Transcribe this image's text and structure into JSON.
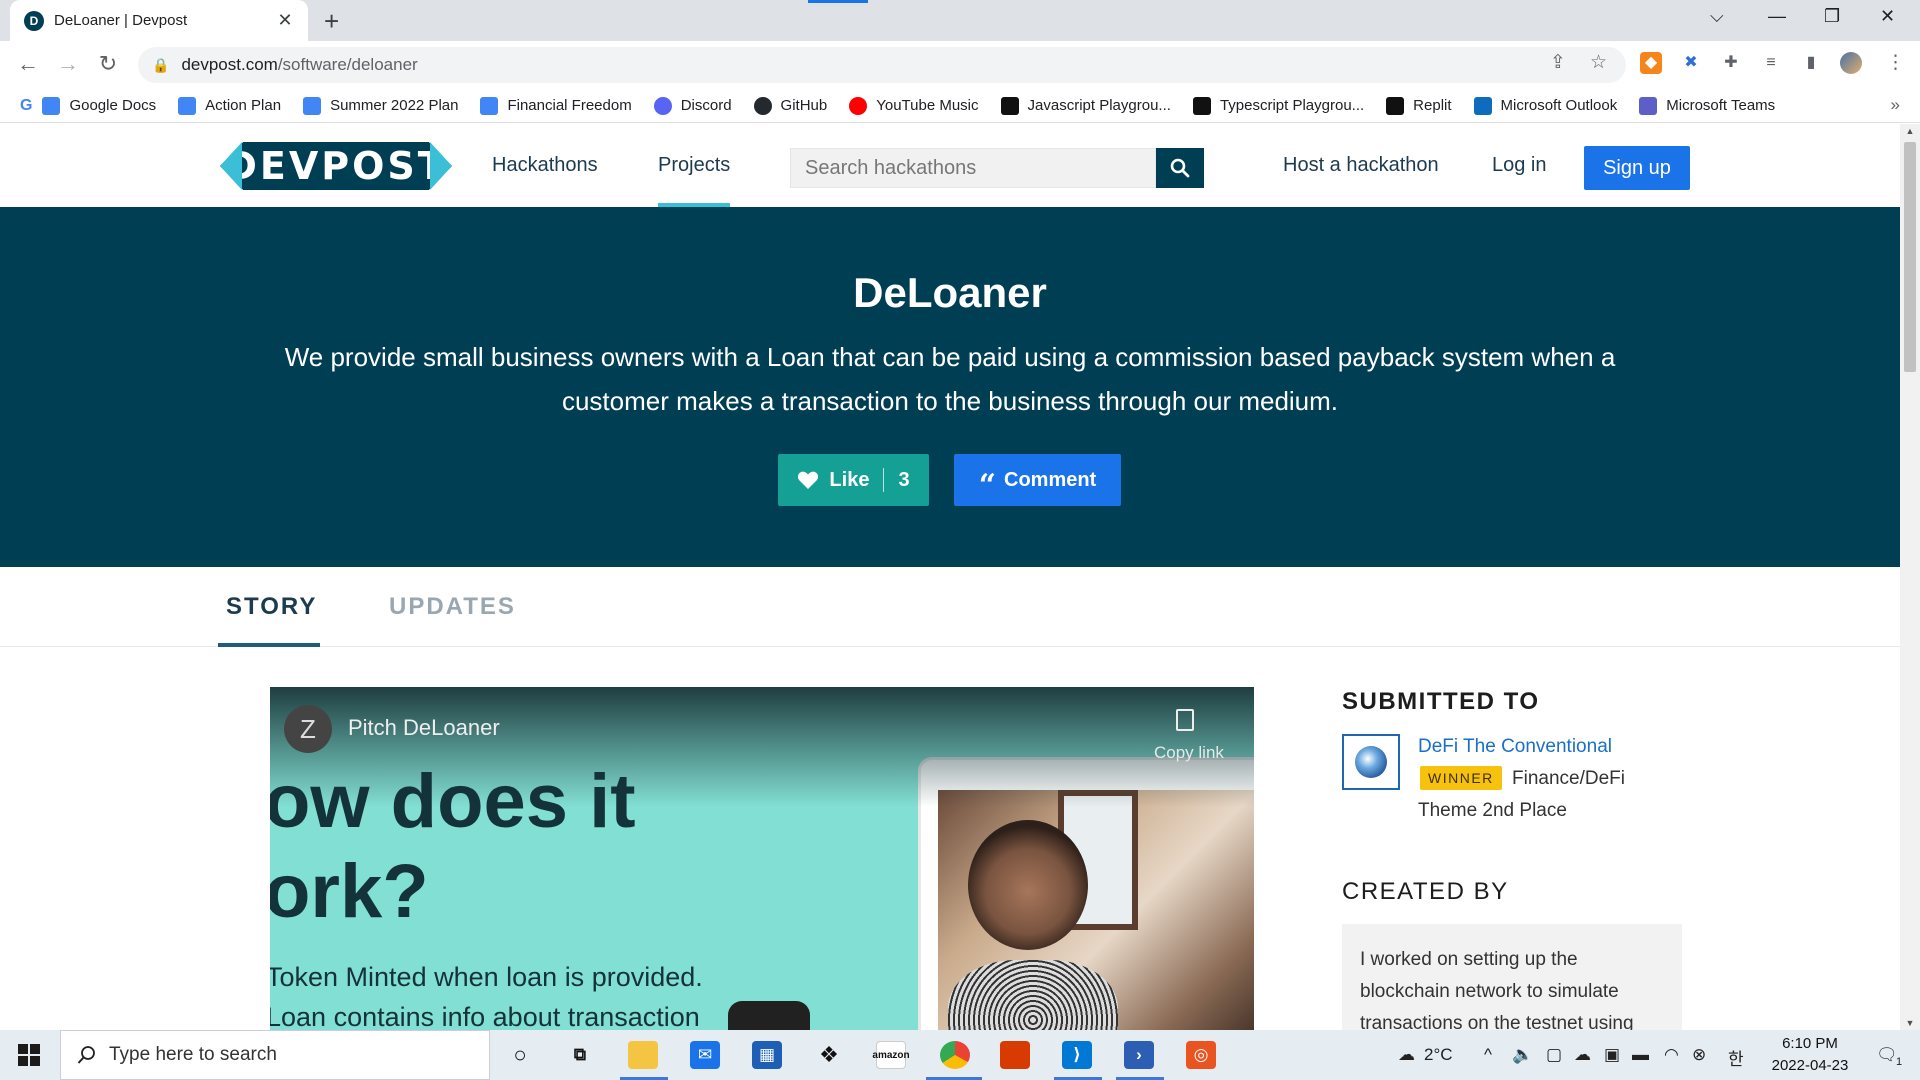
{
  "browser": {
    "tab_title": "DeLoaner | Devpost",
    "tab_favicon": "D",
    "url_host": "devpost.com",
    "url_path": "/software/deloaner",
    "bookmarks": [
      {
        "label": "Google Docs",
        "icon": "docs-icon",
        "color": "#4285f4"
      },
      {
        "label": "Action Plan",
        "icon": "docs-icon",
        "color": "#4285f4"
      },
      {
        "label": "Summer 2022 Plan",
        "icon": "docs-icon",
        "color": "#4285f4"
      },
      {
        "label": "Financial Freedom",
        "icon": "docs-icon",
        "color": "#4285f4"
      },
      {
        "label": "Discord",
        "icon": "discord-icon",
        "color": "#5865f2"
      },
      {
        "label": "GitHub",
        "icon": "github-icon",
        "color": "#24292e"
      },
      {
        "label": "YouTube Music",
        "icon": "youtube-music-icon",
        "color": "#ff0000"
      },
      {
        "label": "Javascript Playgrou...",
        "icon": "playground-icon",
        "color": "#111111"
      },
      {
        "label": "Typescript Playgrou...",
        "icon": "playground-icon",
        "color": "#111111"
      },
      {
        "label": "Replit",
        "icon": "replit-icon",
        "color": "#111111"
      },
      {
        "label": "Microsoft Outlook",
        "icon": "outlook-icon",
        "color": "#0f6cbd"
      },
      {
        "label": "Microsoft Teams",
        "icon": "teams-icon",
        "color": "#5b5fc7"
      }
    ]
  },
  "site": {
    "logo": "DEVPOST",
    "nav": {
      "hackathons": "Hackathons",
      "projects": "Projects"
    },
    "search_placeholder": "Search hackathons",
    "host": "Host a hackathon",
    "login": "Log in",
    "signup": "Sign up"
  },
  "project": {
    "title": "DeLoaner",
    "tagline": "We provide small business owners with a Loan that can be paid using a commission based payback system when a customer makes a transaction to the business through our medium.",
    "like_label": "Like",
    "like_count": "3",
    "comment_label": "Comment"
  },
  "tabs": {
    "story": "STORY",
    "updates": "UPDATES"
  },
  "video": {
    "channel_initial": "Z",
    "title": "Pitch DeLoaner",
    "copy_link": "Copy link",
    "big_line1": "ow does it",
    "big_line2": "ork?",
    "small_line1": "Token Minted when loan is provided.",
    "small_line2": "Loan contains info about transaction"
  },
  "sidebar": {
    "submitted_heading": "SUBMITTED TO",
    "hackathon_name": "DeFi The Conventional",
    "badge": "WINNER",
    "prize_line1": "Finance/DeFi",
    "prize_line2": "Theme 2nd Place",
    "created_heading": "CREATED BY",
    "created_line1": "I worked on setting up the",
    "created_line2": "blockchain network to simulate",
    "created_line3": "transactions on the testnet using"
  },
  "taskbar": {
    "search_placeholder": "Type here to search",
    "temperature": "2°C",
    "time": "6:10 PM",
    "date": "2022-04-23",
    "ime": "한",
    "notifications": "1"
  },
  "colors": {
    "hero_bg": "#003e54",
    "like_bg": "#15a096",
    "primary_blue": "#1a73e8",
    "winner_badge": "#f7c20e",
    "accent_cyan": "#3bbfd6"
  }
}
